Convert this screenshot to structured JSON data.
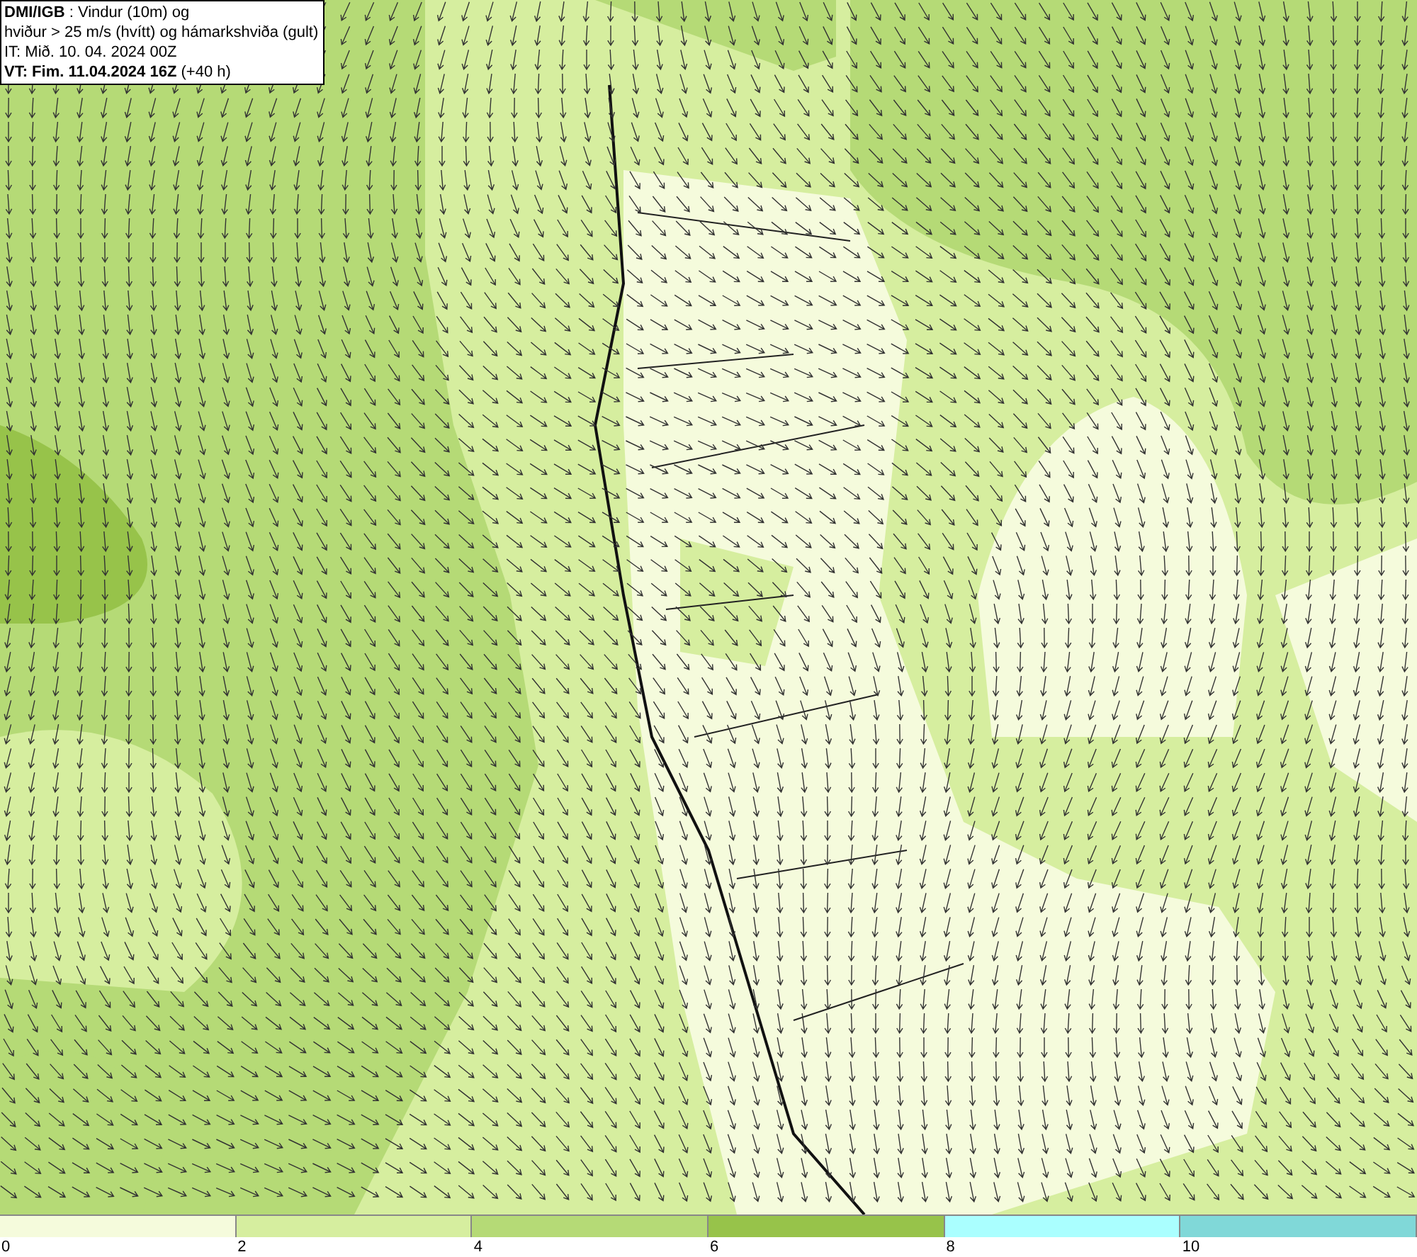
{
  "title_box": {
    "lines": [
      "**DMI/IGB** : Vindur (10m) og",
      "hviður > 25 m/s (hvítt) og hámarkshviða (gult)",
      "IT: Mið. 10. 04. 2024 00Z",
      "**VT: Fim. 11.04.2024 16Z** (+40 h)"
    ]
  },
  "legend": {
    "bins": [
      {
        "color": "#f5fbdc"
      },
      {
        "color": "#d6ee9f"
      },
      {
        "color": "#b5da76"
      },
      {
        "color": "#97c34a"
      },
      {
        "color": "#aaffff"
      },
      {
        "color": "#80d8d8"
      }
    ],
    "ticks": [
      "0",
      "2",
      "4",
      "6",
      "8",
      "10"
    ]
  }
}
